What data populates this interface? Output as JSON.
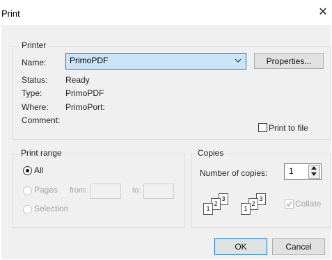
{
  "window": {
    "title": "Print",
    "close_glyph": "✕"
  },
  "printer": {
    "group_label": "Printer",
    "name_label": "Name:",
    "name_value": "PrimoPDF",
    "properties_button": "Properties...",
    "status_label": "Status:",
    "status_value": "Ready",
    "type_label": "Type:",
    "type_value": "PrimoPDF",
    "where_label": "Where:",
    "where_value": "PrimoPort:",
    "comment_label": "Comment:",
    "comment_value": "",
    "print_to_file_label": "Print to file",
    "print_to_file_checked": false
  },
  "print_range": {
    "group_label": "Print range",
    "options": [
      {
        "label": "All",
        "selected": true,
        "enabled": true
      },
      {
        "label": "Pages",
        "selected": false,
        "enabled": false
      },
      {
        "label": "Selection",
        "selected": false,
        "enabled": false
      }
    ],
    "from_label": "from:",
    "to_label": "to:",
    "from_value": "",
    "to_value": ""
  },
  "copies": {
    "group_label": "Copies",
    "number_label": "Number of copies:",
    "number_value": "1",
    "collate_label": "Collate",
    "collate_checked": true,
    "collate_enabled": false,
    "collate_icon_digits": [
      "1",
      "2",
      "3"
    ]
  },
  "footer": {
    "ok_label": "OK",
    "cancel_label": "Cancel"
  },
  "icons": {
    "dropdown": "chevron-down-icon",
    "spin_up": "spin-up-icon",
    "spin_down": "spin-down-icon",
    "close": "close-icon"
  }
}
